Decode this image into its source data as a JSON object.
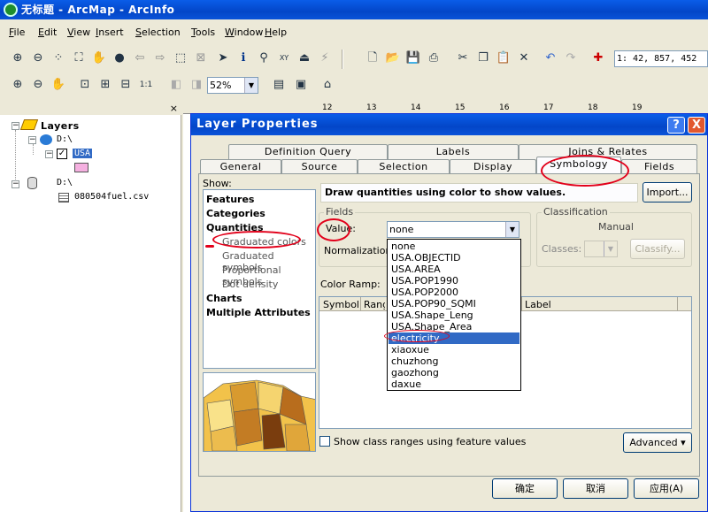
{
  "window": {
    "title": "无标题 - ArcMap - ArcInfo"
  },
  "menu": [
    "File",
    "Edit",
    "View",
    "Insert",
    "Selection",
    "Tools",
    "Window",
    "Help"
  ],
  "toolbar": {
    "coords": "1: 42, 857, 452",
    "zoom": "52%"
  },
  "toc": {
    "root": "Layers",
    "folder1": "D:\\",
    "layer": "USA",
    "folder2": "D:\\",
    "table": "080504fuel.csv"
  },
  "ruler": [
    "12",
    "13",
    "14",
    "15",
    "16",
    "17",
    "18",
    "19"
  ],
  "dialog": {
    "title": "Layer Properties",
    "help": "?",
    "close": "X",
    "tabs_row1": [
      "Definition Query",
      "Labels",
      "Joins & Relates"
    ],
    "tabs_row2": [
      "General",
      "Source",
      "Selection",
      "Display",
      "Symbology",
      "Fields"
    ],
    "show_label": "Show:",
    "show_items": [
      "Features",
      "Categories",
      "Quantities",
      "Graduated colors",
      "Graduated symbols",
      "Proportional symbols",
      "Dot density",
      "Charts",
      "Multiple Attributes"
    ],
    "description": "Draw quantities using color to show values.",
    "import_btn": "Import...",
    "fields_group": "Fields",
    "value_label": "Value:",
    "normalization_label": "Normalization:",
    "value_selected": "none",
    "classification_group": "Classification",
    "classification_method": "Manual",
    "classes_label": "Classes:",
    "classify_btn": "Classify...",
    "color_ramp_label": "Color Ramp:",
    "columns": [
      "Symbol",
      "Range",
      "Label"
    ],
    "dropdown_items": [
      "none",
      "USA.OBJECTID",
      "USA.AREA",
      "USA.POP1990",
      "USA.POP2000",
      "USA.POP90_SQMI",
      "USA.Shape_Leng",
      "USA.Shape_Area",
      "electricity",
      "xiaoxue",
      "chuzhong",
      "gaozhong",
      "daxue"
    ],
    "dropdown_selected": "electricity",
    "show_class_ranges": "Show class ranges using feature values",
    "advanced_btn": "Advanced",
    "ok_btn": "确定",
    "cancel_btn": "取消",
    "apply_btn": "应用(A)"
  },
  "colors": {
    "title_bar": "#0a5de8",
    "selection": "#316ac5",
    "annotation": "#e2001a"
  }
}
